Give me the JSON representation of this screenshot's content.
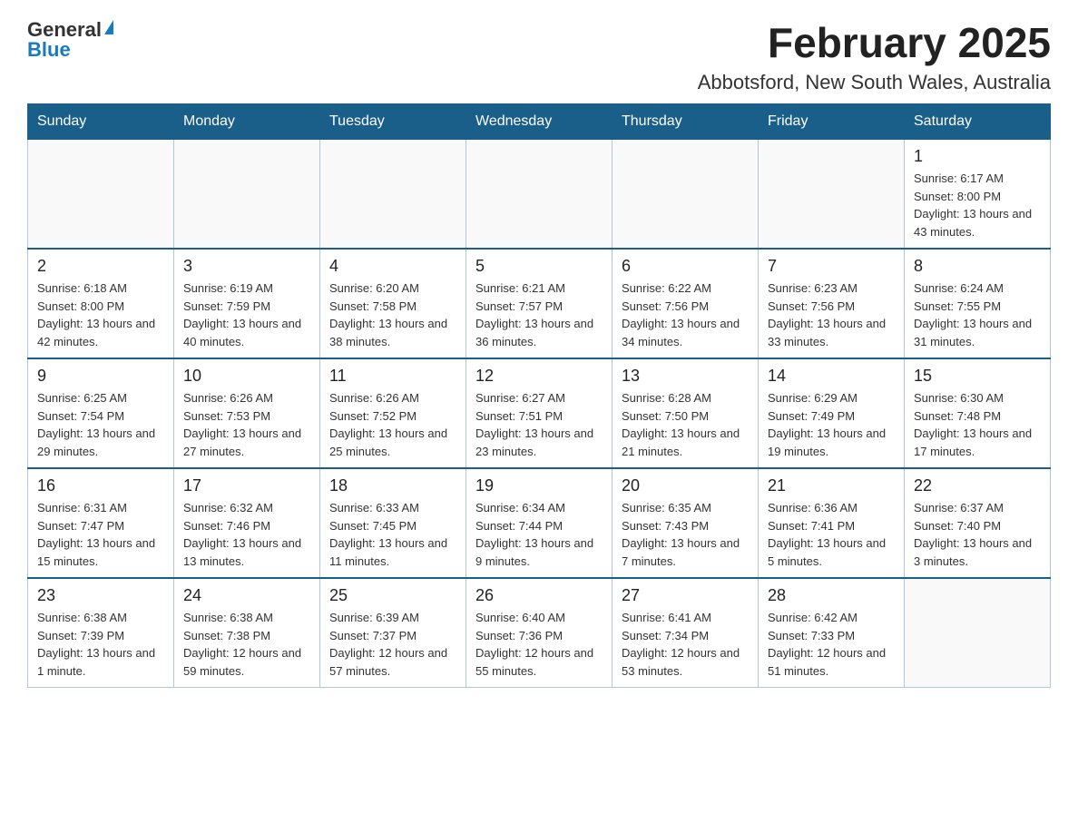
{
  "header": {
    "title": "February 2025",
    "subtitle": "Abbotsford, New South Wales, Australia",
    "logo_general": "General",
    "logo_blue": "Blue"
  },
  "weekdays": [
    "Sunday",
    "Monday",
    "Tuesday",
    "Wednesday",
    "Thursday",
    "Friday",
    "Saturday"
  ],
  "weeks": [
    {
      "days": [
        {
          "number": "",
          "info": ""
        },
        {
          "number": "",
          "info": ""
        },
        {
          "number": "",
          "info": ""
        },
        {
          "number": "",
          "info": ""
        },
        {
          "number": "",
          "info": ""
        },
        {
          "number": "",
          "info": ""
        },
        {
          "number": "1",
          "info": "Sunrise: 6:17 AM\nSunset: 8:00 PM\nDaylight: 13 hours and 43 minutes."
        }
      ]
    },
    {
      "days": [
        {
          "number": "2",
          "info": "Sunrise: 6:18 AM\nSunset: 8:00 PM\nDaylight: 13 hours and 42 minutes."
        },
        {
          "number": "3",
          "info": "Sunrise: 6:19 AM\nSunset: 7:59 PM\nDaylight: 13 hours and 40 minutes."
        },
        {
          "number": "4",
          "info": "Sunrise: 6:20 AM\nSunset: 7:58 PM\nDaylight: 13 hours and 38 minutes."
        },
        {
          "number": "5",
          "info": "Sunrise: 6:21 AM\nSunset: 7:57 PM\nDaylight: 13 hours and 36 minutes."
        },
        {
          "number": "6",
          "info": "Sunrise: 6:22 AM\nSunset: 7:56 PM\nDaylight: 13 hours and 34 minutes."
        },
        {
          "number": "7",
          "info": "Sunrise: 6:23 AM\nSunset: 7:56 PM\nDaylight: 13 hours and 33 minutes."
        },
        {
          "number": "8",
          "info": "Sunrise: 6:24 AM\nSunset: 7:55 PM\nDaylight: 13 hours and 31 minutes."
        }
      ]
    },
    {
      "days": [
        {
          "number": "9",
          "info": "Sunrise: 6:25 AM\nSunset: 7:54 PM\nDaylight: 13 hours and 29 minutes."
        },
        {
          "number": "10",
          "info": "Sunrise: 6:26 AM\nSunset: 7:53 PM\nDaylight: 13 hours and 27 minutes."
        },
        {
          "number": "11",
          "info": "Sunrise: 6:26 AM\nSunset: 7:52 PM\nDaylight: 13 hours and 25 minutes."
        },
        {
          "number": "12",
          "info": "Sunrise: 6:27 AM\nSunset: 7:51 PM\nDaylight: 13 hours and 23 minutes."
        },
        {
          "number": "13",
          "info": "Sunrise: 6:28 AM\nSunset: 7:50 PM\nDaylight: 13 hours and 21 minutes."
        },
        {
          "number": "14",
          "info": "Sunrise: 6:29 AM\nSunset: 7:49 PM\nDaylight: 13 hours and 19 minutes."
        },
        {
          "number": "15",
          "info": "Sunrise: 6:30 AM\nSunset: 7:48 PM\nDaylight: 13 hours and 17 minutes."
        }
      ]
    },
    {
      "days": [
        {
          "number": "16",
          "info": "Sunrise: 6:31 AM\nSunset: 7:47 PM\nDaylight: 13 hours and 15 minutes."
        },
        {
          "number": "17",
          "info": "Sunrise: 6:32 AM\nSunset: 7:46 PM\nDaylight: 13 hours and 13 minutes."
        },
        {
          "number": "18",
          "info": "Sunrise: 6:33 AM\nSunset: 7:45 PM\nDaylight: 13 hours and 11 minutes."
        },
        {
          "number": "19",
          "info": "Sunrise: 6:34 AM\nSunset: 7:44 PM\nDaylight: 13 hours and 9 minutes."
        },
        {
          "number": "20",
          "info": "Sunrise: 6:35 AM\nSunset: 7:43 PM\nDaylight: 13 hours and 7 minutes."
        },
        {
          "number": "21",
          "info": "Sunrise: 6:36 AM\nSunset: 7:41 PM\nDaylight: 13 hours and 5 minutes."
        },
        {
          "number": "22",
          "info": "Sunrise: 6:37 AM\nSunset: 7:40 PM\nDaylight: 13 hours and 3 minutes."
        }
      ]
    },
    {
      "days": [
        {
          "number": "23",
          "info": "Sunrise: 6:38 AM\nSunset: 7:39 PM\nDaylight: 13 hours and 1 minute."
        },
        {
          "number": "24",
          "info": "Sunrise: 6:38 AM\nSunset: 7:38 PM\nDaylight: 12 hours and 59 minutes."
        },
        {
          "number": "25",
          "info": "Sunrise: 6:39 AM\nSunset: 7:37 PM\nDaylight: 12 hours and 57 minutes."
        },
        {
          "number": "26",
          "info": "Sunrise: 6:40 AM\nSunset: 7:36 PM\nDaylight: 12 hours and 55 minutes."
        },
        {
          "number": "27",
          "info": "Sunrise: 6:41 AM\nSunset: 7:34 PM\nDaylight: 12 hours and 53 minutes."
        },
        {
          "number": "28",
          "info": "Sunrise: 6:42 AM\nSunset: 7:33 PM\nDaylight: 12 hours and 51 minutes."
        },
        {
          "number": "",
          "info": ""
        }
      ]
    }
  ]
}
